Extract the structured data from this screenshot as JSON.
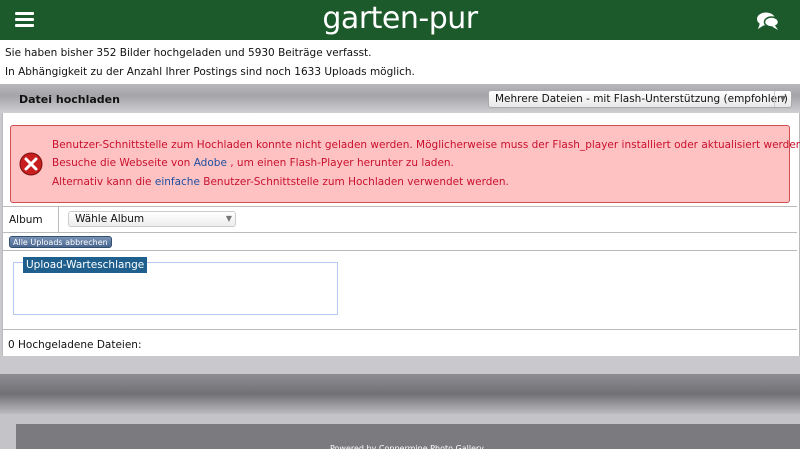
{
  "header": {
    "logo_text": "garten-pur",
    "menu_icon": "hamburger-menu-icon",
    "chat_icon": "chat-bubbles-icon",
    "bg_color": "#1c5a2c"
  },
  "info": {
    "line1": "Sie haben bisher 352 Bilder hochgeladen und 5930 Beiträge verfasst.",
    "line2": "In Abhängigkeit zu der Anzahl Ihrer Postings sind noch 1633 Uploads möglich."
  },
  "panel": {
    "title": "Datei hochladen",
    "mode_selected": "Mehrere Dateien - mit Flash-Unterstützung (empfohlen)"
  },
  "error": {
    "icon": "error-x-icon",
    "line1": "Benutzer-Schnittstelle zum Hochladen konnte nicht geladen werden. Möglicherweise muss der Flash_player installiert oder aktualisiert werden.",
    "line2_pre": "Besuche die Webseite von",
    "line2_link": "Adobe",
    "line2_post": ", um einen Flash-Player herunter zu laden.",
    "line3_pre": "Alternativ kann die",
    "line3_link": "einfache",
    "line3_post": "Benutzer-Schnittstelle zum Hochladen verwendet werden."
  },
  "album": {
    "label": "Album",
    "selected": "Wähle Album"
  },
  "buttons": {
    "cancel_all": "Alle Uploads abbrechen"
  },
  "queue": {
    "legend": "Upload-Warteschlange"
  },
  "status": {
    "uploaded": "0 Hochgeladene Dateien:"
  },
  "footer": {
    "powered": "Powered by Coppermine Photo Gallery"
  }
}
